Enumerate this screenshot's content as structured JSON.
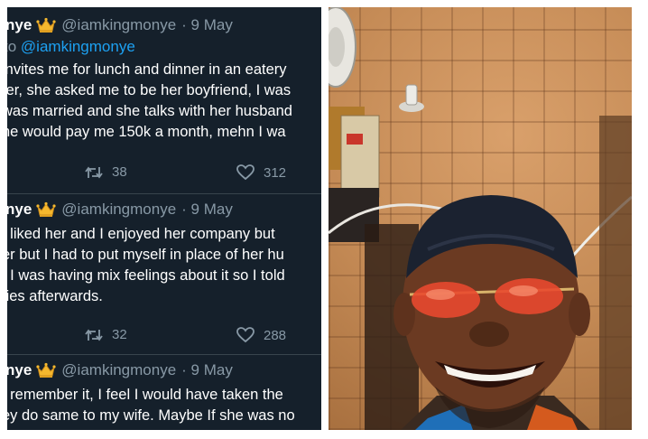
{
  "tweets": [
    {
      "name": "nye",
      "handle": "@iamkingmonye",
      "date": "· 9 May",
      "reply_to": "to",
      "reply_handle": "@iamkingmonye",
      "lines": [
        "invites me for lunch and dinner in an eatery",
        "ter, she asked me to be her boyfriend, I was",
        "was married and she talks with her husband",
        "he would pay me 150k a month, mehn I wa"
      ],
      "retweets": "38",
      "likes": "312"
    },
    {
      "name": "nye",
      "handle": "@iamkingmonye",
      "date": "· 9 May",
      "lines": [
        "I liked her and I enjoyed her company but",
        "er but I had to put myself in place of her hu",
        ", I was having mix feelings about it so I told",
        "ties afterwards."
      ],
      "retweets": "32",
      "likes": "288"
    },
    {
      "name": "nye",
      "handle": "@iamkingmonye",
      "date": "· 9 May",
      "lines": [
        "I remember it, I feel I would have taken the",
        "ey do same to my wife. Maybe If she was no"
      ]
    }
  ],
  "colors": {
    "background": "#15202b",
    "text": "#ffffff",
    "muted": "#8899a6",
    "link": "#1da1f2",
    "divider": "#38444d"
  },
  "icons": [
    "crown-icon",
    "retweet-icon",
    "heart-icon"
  ]
}
